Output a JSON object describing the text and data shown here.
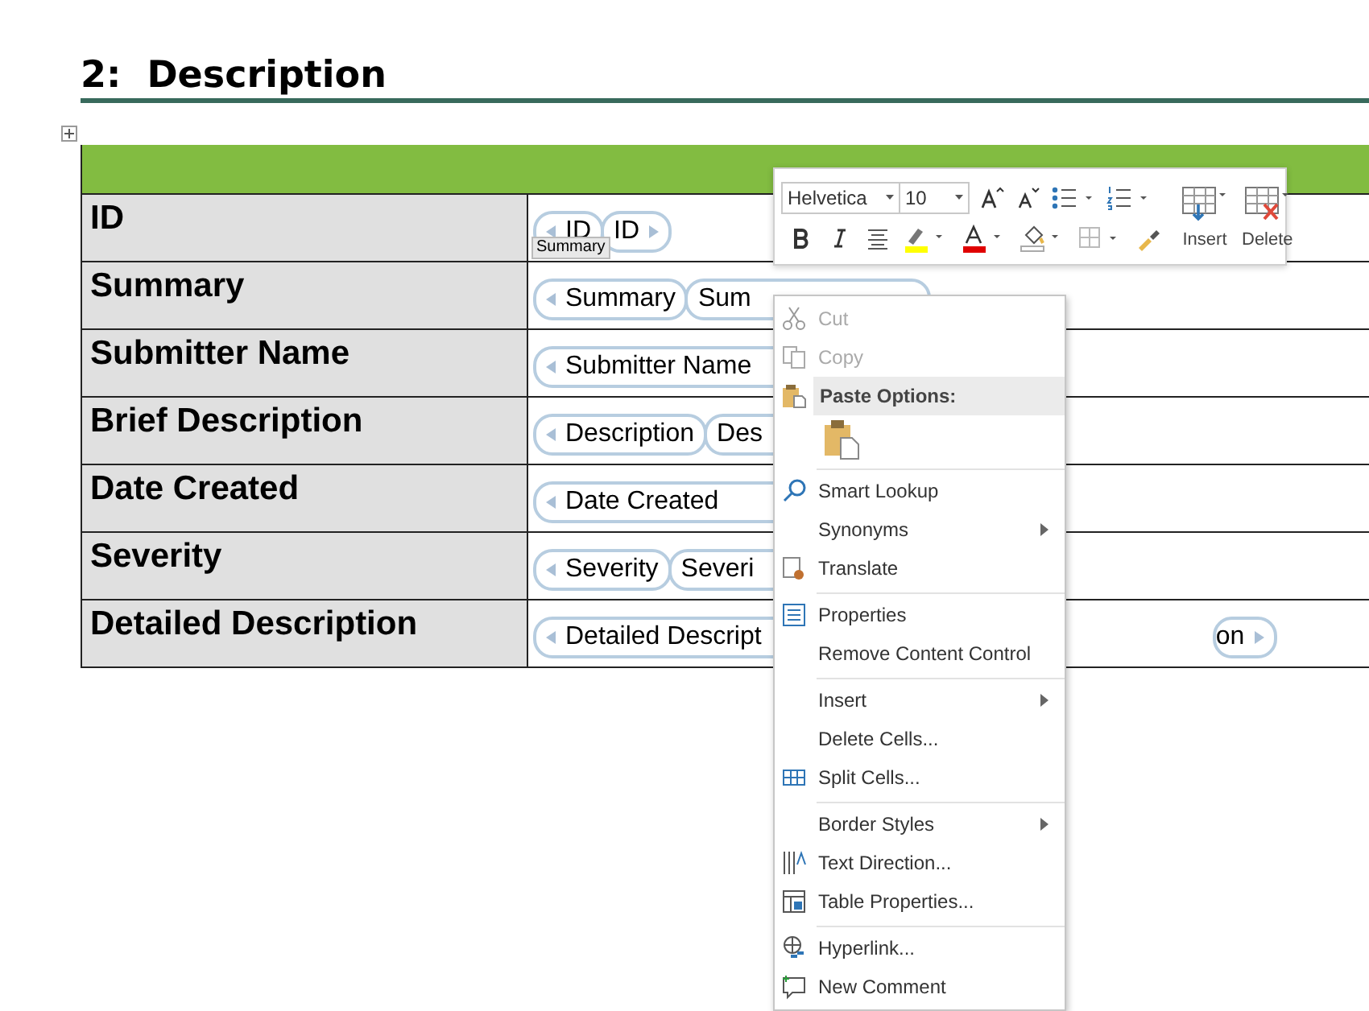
{
  "heading": "2:  Description",
  "table": {
    "rows": [
      {
        "label": "ID",
        "controls": [
          {
            "text": "ID",
            "start": true,
            "end": false
          },
          {
            "text": "ID",
            "start": false,
            "end": true
          }
        ],
        "tag": "Summary"
      },
      {
        "label": "Summary",
        "controls": [
          {
            "text": "Summary",
            "start": true,
            "end": false
          },
          {
            "text": "Sum",
            "start": false,
            "end": false
          }
        ]
      },
      {
        "label": "Submitter Name",
        "controls": [
          {
            "text": "Submitter Name",
            "start": true,
            "end": false
          }
        ]
      },
      {
        "label": "Brief Description",
        "controls": [
          {
            "text": "Description",
            "start": true,
            "end": false
          },
          {
            "text": "Des",
            "start": false,
            "end": false
          }
        ]
      },
      {
        "label": "Date Created",
        "controls": [
          {
            "text": "Date Created",
            "start": true,
            "end": false
          }
        ]
      },
      {
        "label": "Severity",
        "controls": [
          {
            "text": "Severity",
            "start": true,
            "end": false
          },
          {
            "text": "Severi",
            "start": false,
            "end": false
          }
        ]
      },
      {
        "label": "Detailed Description",
        "controls": [
          {
            "text": "Detailed Descript",
            "start": true,
            "end": false
          },
          {
            "text": "on",
            "start": false,
            "end": true
          }
        ]
      }
    ]
  },
  "mini_toolbar": {
    "font": "Helvetica",
    "size": "10",
    "buttons": [
      "Insert",
      "Delete"
    ]
  },
  "context_menu": [
    {
      "label": "Cut",
      "kind": "item",
      "disabled": true,
      "icon": true,
      "submenu": false,
      "separator_before": false
    },
    {
      "label": "Copy",
      "kind": "item",
      "disabled": true,
      "icon": true,
      "submenu": false,
      "separator_before": false
    },
    {
      "label": "Paste Options:",
      "kind": "header"
    },
    {
      "kind": "paste"
    },
    {
      "label": "Smart Lookup",
      "kind": "item",
      "disabled": false,
      "icon": true,
      "submenu": false,
      "separator_before": true
    },
    {
      "label": "Synonyms",
      "kind": "item",
      "disabled": false,
      "icon": false,
      "submenu": true,
      "separator_before": false
    },
    {
      "label": "Translate",
      "kind": "item",
      "disabled": false,
      "icon": true,
      "submenu": false,
      "separator_before": false
    },
    {
      "label": "Properties",
      "kind": "item",
      "disabled": false,
      "icon": true,
      "submenu": false,
      "separator_before": true
    },
    {
      "label": "Remove Content Control",
      "kind": "item",
      "disabled": false,
      "icon": false,
      "submenu": false,
      "separator_before": false
    },
    {
      "label": "Insert",
      "kind": "item",
      "disabled": false,
      "icon": false,
      "submenu": true,
      "separator_before": true
    },
    {
      "label": "Delete Cells...",
      "kind": "item",
      "disabled": false,
      "icon": false,
      "submenu": false,
      "separator_before": false
    },
    {
      "label": "Split Cells...",
      "kind": "item",
      "disabled": false,
      "icon": true,
      "submenu": false,
      "separator_before": false
    },
    {
      "label": "Border Styles",
      "kind": "item",
      "disabled": false,
      "icon": false,
      "submenu": true,
      "separator_before": true
    },
    {
      "label": "Text Direction...",
      "kind": "item",
      "disabled": false,
      "icon": true,
      "submenu": false,
      "separator_before": false
    },
    {
      "label": "Table Properties...",
      "kind": "item",
      "disabled": false,
      "icon": true,
      "submenu": false,
      "separator_before": false
    },
    {
      "label": "Hyperlink...",
      "kind": "item",
      "disabled": false,
      "icon": true,
      "submenu": false,
      "separator_before": true
    },
    {
      "label": "New Comment",
      "kind": "item",
      "disabled": false,
      "icon": true,
      "submenu": false,
      "separator_before": false
    }
  ]
}
